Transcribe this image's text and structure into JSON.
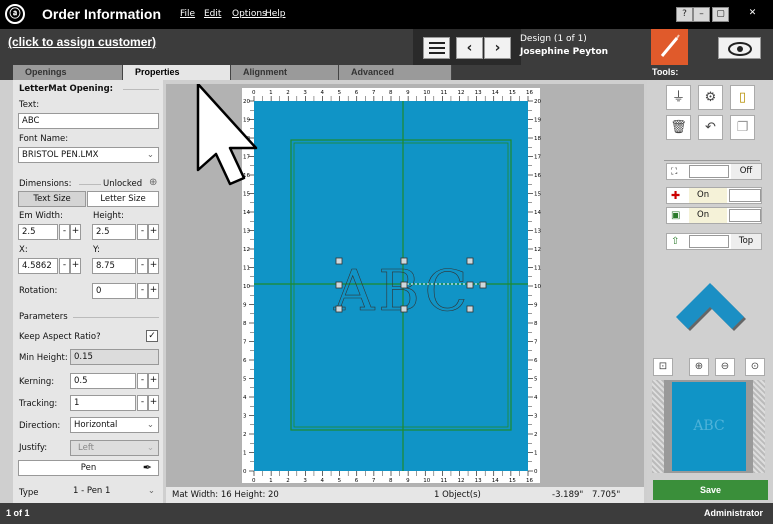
{
  "app": {
    "title": "Order Information",
    "logo": "ⓐ"
  },
  "menu": [
    "File",
    "Edit",
    "Options",
    "Help"
  ],
  "window_buttons": [
    "?",
    "–",
    "▢",
    "✕"
  ],
  "header": {
    "customer": "(click to assign customer)",
    "design": "Design  (1 of 1)",
    "designer": "Josephine Peyton"
  },
  "tabs": [
    "Openings",
    "Properties",
    "Alignment",
    "Advanced"
  ],
  "tools_label": "Tools:",
  "props": {
    "opening_title": "LetterMat Opening:",
    "text_label": "Text:",
    "text_value": "ABC",
    "font_label": "Font Name:",
    "font_value": "BRISTOL PEN.LMX",
    "dimensions_label": "Dimensions:",
    "unlocked": "Unlocked",
    "text_size": "Text Size",
    "letter_size": "Letter Size",
    "em_width_label": "Em Width:",
    "height_label": "Height:",
    "em_width": "2.5",
    "height": "2.5",
    "x_label": "X:",
    "y_label": "Y:",
    "x": "4.5862",
    "y": "8.75",
    "rotation_label": "Rotation:",
    "rotation": "0",
    "parameters_label": "Parameters",
    "keep_aspect": "Keep Aspect Ratio?",
    "min_height_label": "Min Height:",
    "min_height": "0.15",
    "kerning_label": "Kerning:",
    "kerning": "0.5",
    "tracking_label": "Tracking:",
    "tracking": "1",
    "direction_label": "Direction:",
    "direction": "Horizontal",
    "justify_label": "Justify:",
    "justify": "Left",
    "pen_button": "Pen",
    "type_label": "Type",
    "type_value": "1 - Pen 1"
  },
  "status": {
    "mat": "Mat Width: 16 Height: 20",
    "objects": "1 Object(s)",
    "coord_x": "-3.189\"",
    "coord_y": "7.705\""
  },
  "toggles": {
    "first": "Off",
    "second": "On",
    "third": "On",
    "fourth": "Top"
  },
  "save": "Save",
  "bottom": {
    "page": "1 of 1",
    "user": "Administrator"
  },
  "canvas_text": "ABC",
  "ruler_top": [
    "0",
    "1",
    "2",
    "3",
    "4",
    "5",
    "6",
    "7",
    "8",
    "9",
    "10",
    "11",
    "12",
    "13",
    "14",
    "15",
    "16"
  ],
  "ruler_side": [
    "20",
    "19",
    "18",
    "17",
    "16",
    "15",
    "14",
    "13",
    "12",
    "11",
    "10",
    "9",
    "8",
    "7",
    "6",
    "5",
    "4",
    "3",
    "2",
    "1",
    "0"
  ],
  "colors": {
    "mat": "#1094c6",
    "guide": "#1e8a2e",
    "save": "#3a8f3a",
    "pen_tool": "#e05a2b",
    "chevron": "#1b8fc4"
  },
  "icons": [
    "pen-tool-icon",
    "eye-icon",
    "gear-icon",
    "ruler-icon",
    "trash-icon",
    "undo-icon",
    "layers-icon",
    "zoom-in-icon",
    "zoom-out-icon",
    "zoom-fit-icon"
  ]
}
